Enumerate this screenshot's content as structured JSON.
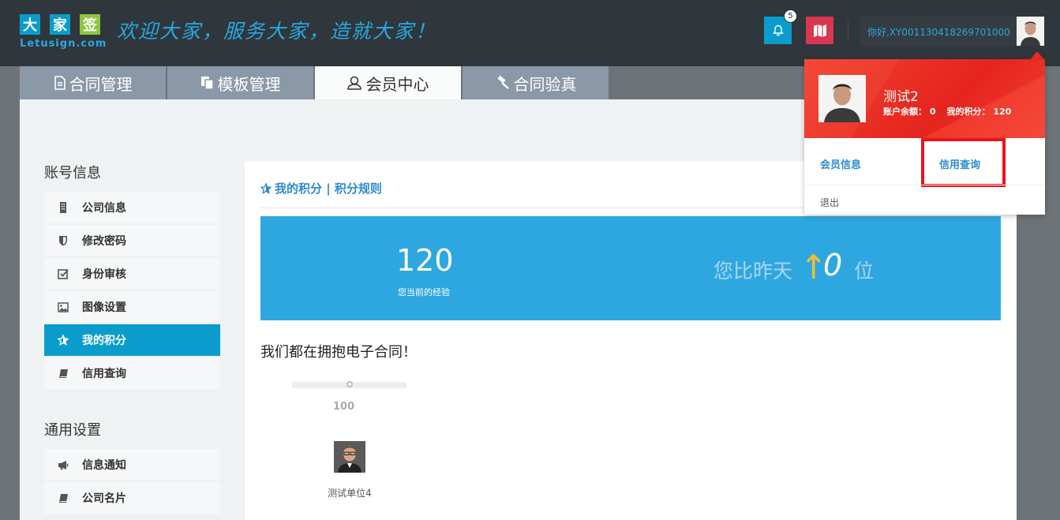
{
  "brand": {
    "chars": [
      "大",
      "家",
      "签"
    ],
    "char_colors": [
      "#0a9dcc",
      "#0a9dcc",
      "#8cc63f"
    ],
    "sub": "Letusign.com",
    "slogan": "欢迎大家，服务大家，造就大家！"
  },
  "header": {
    "notification_count": "5",
    "greeting": "你好,XY001130418269701000",
    "bell_color": "#0a9dcc",
    "map_color": "#d9364f"
  },
  "tabs": [
    {
      "label": "合同管理",
      "icon": "document-icon"
    },
    {
      "label": "模板管理",
      "icon": "copy-icon"
    },
    {
      "label": "会员中心",
      "icon": "user-icon"
    },
    {
      "label": "合同验真",
      "icon": "gavel-icon"
    }
  ],
  "sidebar": {
    "account_title": "账号信息",
    "account_items": [
      {
        "label": "公司信息",
        "icon": "building-icon"
      },
      {
        "label": "修改密码",
        "icon": "shield-icon"
      },
      {
        "label": "身份审核",
        "icon": "check-square-icon"
      },
      {
        "label": "图像设置",
        "icon": "image-icon"
      },
      {
        "label": "我的积分",
        "icon": "star-icon"
      },
      {
        "label": "信用查询",
        "icon": "book-icon"
      }
    ],
    "general_title": "通用设置",
    "general_items": [
      {
        "label": "信息通知",
        "icon": "megaphone-icon"
      },
      {
        "label": "公司名片",
        "icon": "book-icon"
      }
    ]
  },
  "main": {
    "heading": "我的积分 | 积分规则",
    "points": "120",
    "points_caption": "您当前的经验",
    "rank_prefix": "您比昨天",
    "rank_arrow": "↑",
    "rank_value": "0",
    "rank_unit": "位",
    "slogan": "我们都在拥抱电子合同！",
    "progress_label": "100",
    "progress_fraction": 0.5,
    "member_name": "测试单位4"
  },
  "dropdown": {
    "name": "测试2",
    "balance": "账户余额： 0",
    "points": "我的积分： 120",
    "link_member": "会员信息",
    "link_credit": "信用查询",
    "logout": "退出"
  }
}
